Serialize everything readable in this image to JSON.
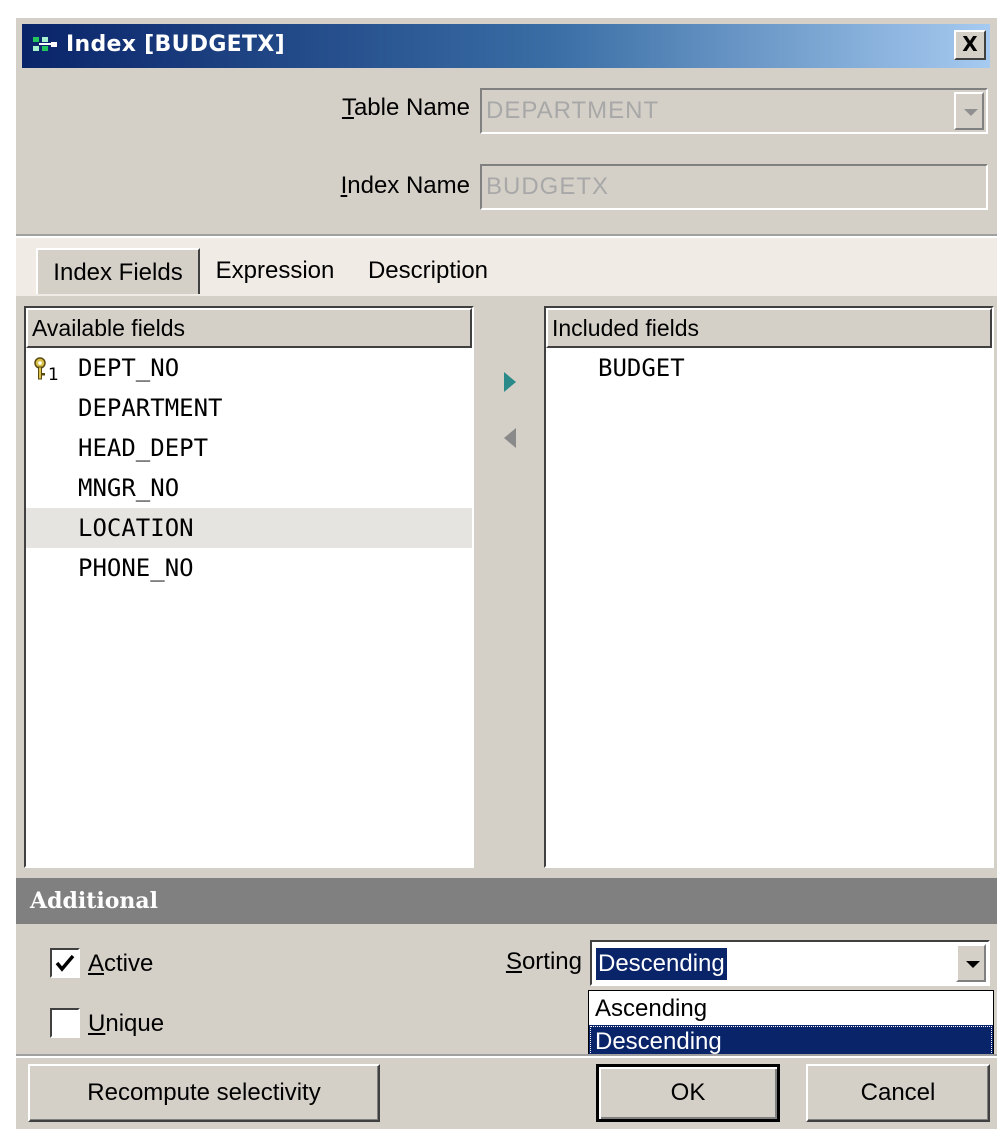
{
  "window": {
    "title": "Index [BUDGETX]",
    "close_label": "X"
  },
  "form": {
    "table_name_label_prefix": "T",
    "table_name_label_rest": "able Name",
    "table_name_value": "DEPARTMENT",
    "index_name_label_prefix": "I",
    "index_name_label_rest": "ndex Name",
    "index_name_value": "BUDGETX"
  },
  "tabs": [
    {
      "label": "Index Fields",
      "active": true
    },
    {
      "label": "Expression",
      "active": false
    },
    {
      "label": "Description",
      "active": false
    }
  ],
  "available": {
    "header": "Available fields",
    "key_subscript": "1",
    "items": [
      "DEPT_NO",
      "DEPARTMENT",
      "HEAD_DEPT",
      "MNGR_NO",
      "LOCATION",
      "PHONE_NO"
    ],
    "highlighted_index": 4
  },
  "included": {
    "header": "Included fields",
    "items": [
      "BUDGET"
    ]
  },
  "additional": {
    "title": "Additional",
    "active_label_prefix": "A",
    "active_label_rest": "ctive",
    "active_checked": true,
    "unique_label_prefix": "U",
    "unique_label_rest": "nique",
    "unique_checked": false,
    "sorting_label_prefix": "S",
    "sorting_label_rest": "orting",
    "sorting_value": "Descending",
    "sorting_options": [
      "Ascending",
      "Descending"
    ]
  },
  "buttons": {
    "recompute": "Recompute selectivity",
    "ok": "OK",
    "cancel": "Cancel"
  },
  "colors": {
    "title_bar": "#0a246a",
    "dialog_bg": "#d4d0c8",
    "selection": "#0a246a",
    "arrow_teal": "#2a8a8a"
  }
}
